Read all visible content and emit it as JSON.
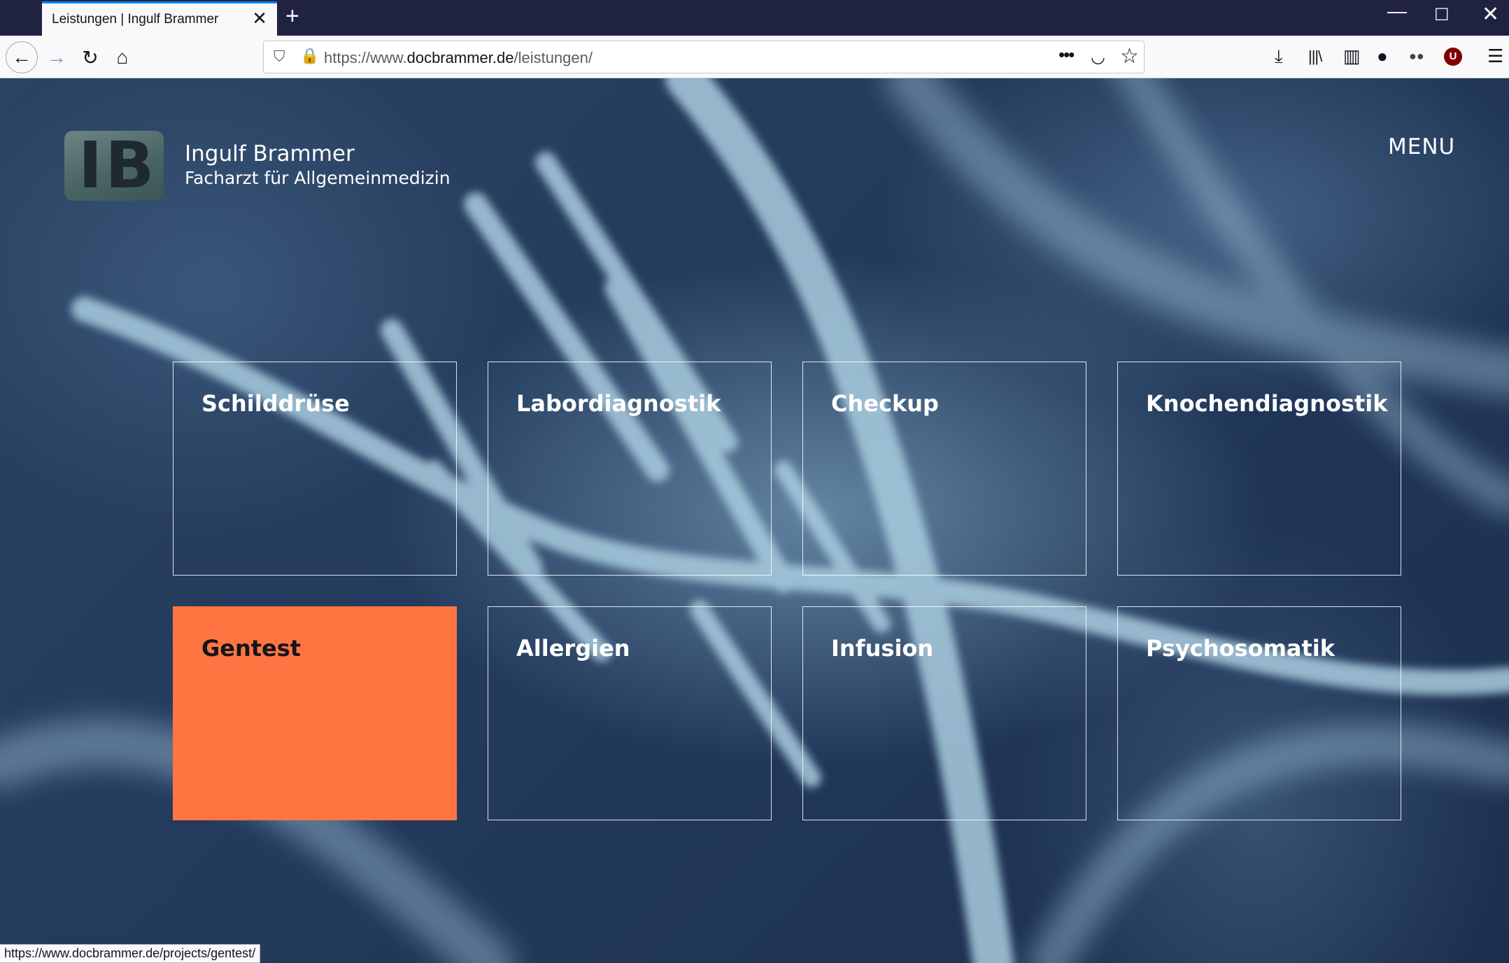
{
  "browser": {
    "tab": {
      "title": "Leistungen | Ingulf Brammer",
      "close_glyph": "✕"
    },
    "new_tab_glyph": "+",
    "window_controls": {
      "minimize": "—",
      "maximize": "☐",
      "close": "✕"
    },
    "nav": {
      "back": "←",
      "forward": "→",
      "reload": "↻",
      "home": "⌂"
    },
    "url": {
      "prefix": "https://www.",
      "domain": "docbrammer.de",
      "path": "/leistungen/"
    },
    "url_icons": {
      "shield": "⛉",
      "lock": "🔒",
      "more": "•••",
      "pocket": "◡",
      "star": "☆"
    },
    "toolbar_icons": {
      "downloads": "⤓",
      "library": "|||\\",
      "sidebar": "▥",
      "account": "●",
      "extension": "●●",
      "ublock": "U",
      "menu": "☰"
    },
    "status_url": "https://www.docbrammer.de/projects/gentest/"
  },
  "header": {
    "logo_text": "IB",
    "name": "Ingulf Brammer",
    "subtitle": "Facharzt für Allgemeinmedizin",
    "menu_label": "MENU"
  },
  "services": [
    {
      "label": "Schilddrüse",
      "active": false
    },
    {
      "label": "Labordiagnostik",
      "active": false
    },
    {
      "label": "Checkup",
      "active": false
    },
    {
      "label": "Knochendiagnostik",
      "active": false
    },
    {
      "label": "Gentest",
      "active": true
    },
    {
      "label": "Allergien",
      "active": false
    },
    {
      "label": "Infusion",
      "active": false
    },
    {
      "label": "Psychosomatik",
      "active": false
    }
  ],
  "colors": {
    "accent": "#ff7542",
    "tab_indicator": "#0a84ff",
    "titlebar": "#202340",
    "page_background": "#233a5c"
  }
}
